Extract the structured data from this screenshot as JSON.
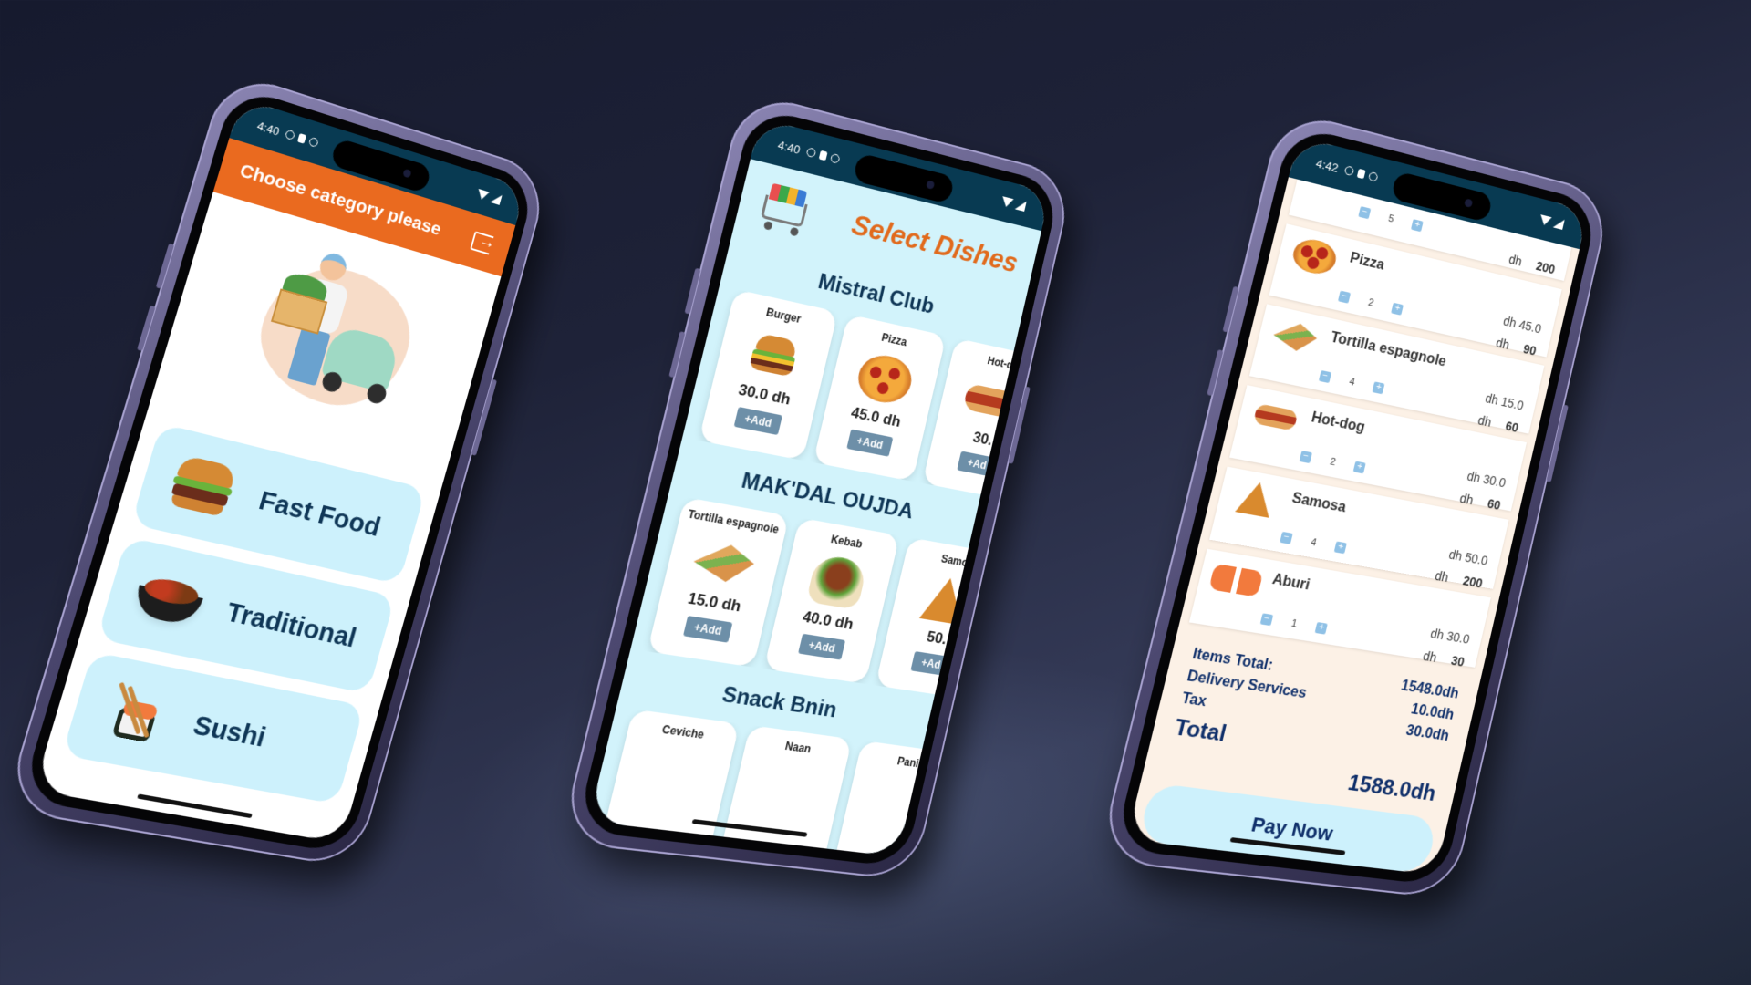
{
  "phone1": {
    "status_time": "4:40",
    "appbar_title": "Choose category please",
    "categories": [
      {
        "label": "Fast Food",
        "icon": "burger-icon"
      },
      {
        "label": "Traditional",
        "icon": "tajine-icon"
      },
      {
        "label": "Sushi",
        "icon": "sushi-icon"
      }
    ],
    "colors": {
      "appbar": "#ea6a1f",
      "card": "#cdf1fc",
      "text": "#0f3656"
    }
  },
  "phone2": {
    "status_time": "4:40",
    "title": "Select Dishes",
    "sections": [
      {
        "name": "Mistral Club",
        "dishes": [
          {
            "name": "Burger",
            "price": "30.0 dh",
            "add": "+Add"
          },
          {
            "name": "Pizza",
            "price": "45.0 dh",
            "add": "+Add"
          },
          {
            "name": "Hot-d",
            "price": "30.",
            "add": "+Ad"
          }
        ]
      },
      {
        "name": "MAK'DAL OUJDA",
        "dishes": [
          {
            "name": "Tortilla espagnole",
            "price": "15.0 dh",
            "add": "+Add"
          },
          {
            "name": "Kebab",
            "price": "40.0 dh",
            "add": "+Add"
          },
          {
            "name": "Samo",
            "price": "50.",
            "add": "+Ad"
          }
        ]
      },
      {
        "name": "Snack Bnin",
        "dishes": [
          {
            "name": "Ceviche"
          },
          {
            "name": "Naan"
          },
          {
            "name": "Pani"
          }
        ]
      }
    ]
  },
  "phone3": {
    "status_time": "4:42",
    "top_partial": {
      "qty": "5",
      "line_currency": "dh",
      "line_total": "200"
    },
    "items": [
      {
        "name": "Pizza",
        "qty": "2",
        "unit_currency": "dh",
        "unit_price": "45.0",
        "line_currency": "dh",
        "line_total": "90"
      },
      {
        "name": "Tortilla espagnole",
        "qty": "4",
        "unit_currency": "dh",
        "unit_price": "15.0",
        "line_currency": "dh",
        "line_total": "60"
      },
      {
        "name": "Hot-dog",
        "qty": "2",
        "unit_currency": "dh",
        "unit_price": "30.0",
        "line_currency": "dh",
        "line_total": "60"
      },
      {
        "name": "Samosa",
        "qty": "4",
        "unit_currency": "dh",
        "unit_price": "50.0",
        "line_currency": "dh",
        "line_total": "200"
      },
      {
        "name": "Aburi",
        "qty": "1",
        "unit_currency": "dh",
        "unit_price": "30.0",
        "line_currency": "dh",
        "line_total": "30"
      }
    ],
    "summary": {
      "items_total_label": "Items Total:",
      "items_total": "1548.0dh",
      "delivery_label": "Delivery Services",
      "delivery": "10.0dh",
      "tax_label": "Tax",
      "tax": "30.0dh",
      "total_label": "Total",
      "total": "1588.0dh"
    },
    "pay_button": "Pay Now"
  }
}
